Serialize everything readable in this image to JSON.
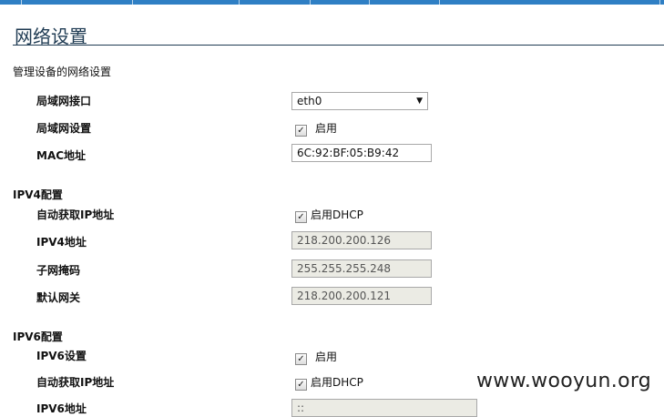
{
  "page": {
    "title": "网络设置",
    "description": "管理设备的网络设置"
  },
  "lan": {
    "interface_label": "局域网接口",
    "interface_value": "eth0",
    "setting_label": "局域网设置",
    "setting_checked": true,
    "setting_check_label": "启用",
    "mac_label": "MAC地址",
    "mac_value": "6C:92:BF:05:B9:42"
  },
  "ipv4": {
    "heading": "IPV4配置",
    "auto_ip_label": "自动获取IP地址",
    "auto_ip_checked": true,
    "auto_ip_check_label": "启用DHCP",
    "address_label": "IPV4地址",
    "address_value": "218.200.200.126",
    "subnet_label": "子网掩码",
    "subnet_value": "255.255.255.248",
    "gateway_label": "默认网关",
    "gateway_value": "218.200.200.121"
  },
  "ipv6": {
    "heading": "IPV6配置",
    "setting_label": "IPV6设置",
    "setting_checked": true,
    "setting_check_label": "启用",
    "auto_ip_label": "自动获取IP地址",
    "auto_ip_checked": true,
    "auto_ip_check_label": "启用DHCP",
    "address_label": "IPV6地址",
    "address_value": "::"
  },
  "watermark": "www.wooyun.org",
  "colors": {
    "top_bar": "#2f7fc4",
    "title": "#1f3b53",
    "readonly_field": "#ebebe4"
  }
}
